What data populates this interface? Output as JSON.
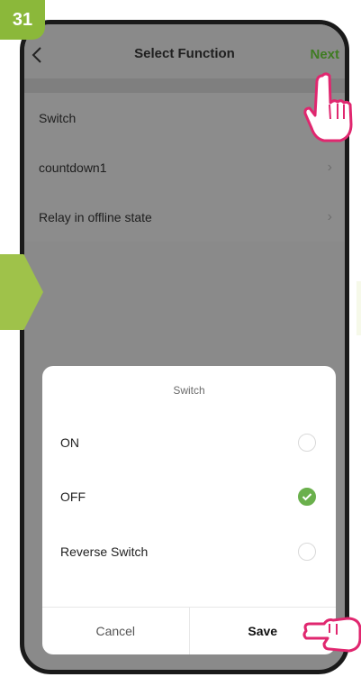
{
  "step_number": "31",
  "header": {
    "back_icon": "chevron-left-icon",
    "title": "Select Function",
    "next_label": "Next"
  },
  "list": {
    "items": [
      {
        "label": "Switch"
      },
      {
        "label": "countdown1"
      },
      {
        "label": "Relay in offline state"
      }
    ]
  },
  "sheet": {
    "title": "Switch",
    "options": [
      {
        "label": "ON",
        "selected": false
      },
      {
        "label": "OFF",
        "selected": true
      },
      {
        "label": "Reverse Switch",
        "selected": false
      }
    ],
    "cancel_label": "Cancel",
    "save_label": "Save"
  },
  "colors": {
    "accent_green": "#6ab04c",
    "next_green": "#3f7c22",
    "badge_green": "#8bb83a",
    "pointer_pink": "#e0276f"
  }
}
